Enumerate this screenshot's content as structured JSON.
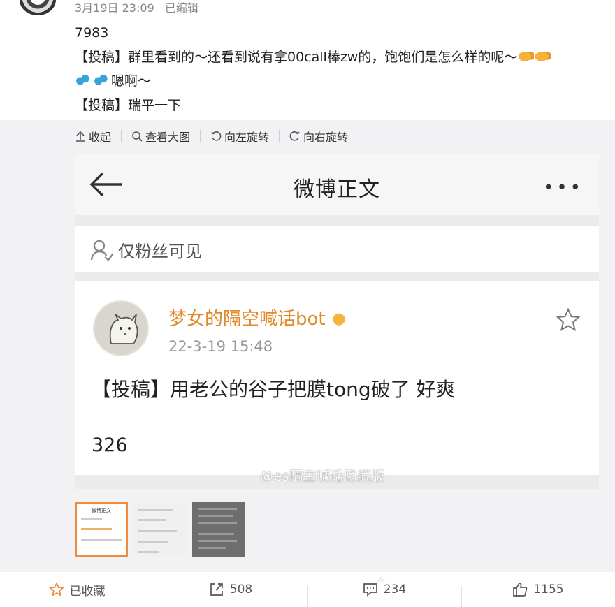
{
  "post": {
    "timestamp": "3月19日 23:09",
    "edited": "已编辑",
    "lines": [
      "7983",
      "【投稿】群里看到的～还看到说有拿00call棒zw的，饱饱们是怎么样的呢～",
      "嗯啊～",
      "【投稿】瑞平一下"
    ]
  },
  "toolbar": {
    "collapse": "收起",
    "view_large": "查看大图",
    "rotate_left": "向左旋转",
    "rotate_right": "向右旋转"
  },
  "screenshot": {
    "nav_title": "微博正文",
    "more": "•••",
    "visibility": "仅粉丝可见",
    "author": "梦女的隔空喊话bot",
    "date": "22-3-19 15:48",
    "body": "【投稿】用老公的谷子把膜tong破了 好爽",
    "count": "326",
    "watermark": "@es隔空喊话隐藏版"
  },
  "thumbnails": {
    "first_title": "微博正文"
  },
  "actions": {
    "favorite": "已收藏",
    "repost": "508",
    "comment": "234",
    "like": "1155"
  },
  "colors": {
    "accent_orange": "#f08a3c",
    "author_orange": "#e08a2a",
    "panel_bg": "#f2f2f5"
  }
}
